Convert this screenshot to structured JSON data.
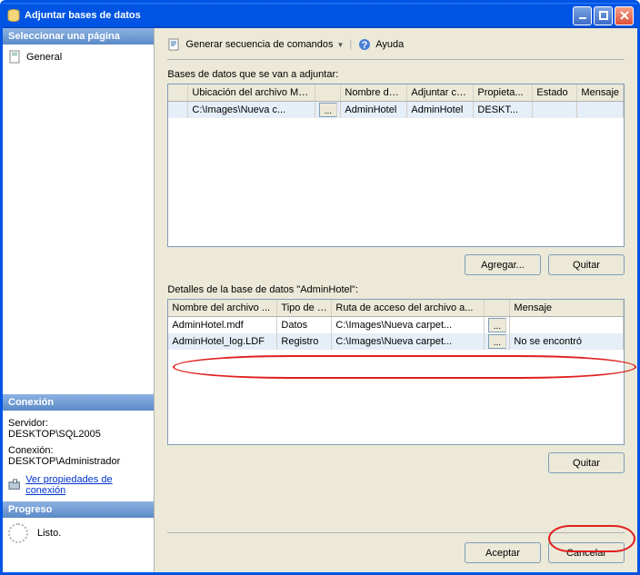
{
  "window": {
    "title": "Adjuntar bases de datos"
  },
  "sidebar": {
    "select_page": "Seleccionar una página",
    "general": "General",
    "connection_hdr": "Conexión",
    "server_label": "Servidor:",
    "server_value": "DESKTOP\\SQL2005",
    "conn_label": "Conexión:",
    "conn_value": "DESKTOP\\Administrador",
    "view_props": "Ver propiedades de conexión",
    "progress_hdr": "Progreso",
    "progress_status": "Listo."
  },
  "toolbar": {
    "script": "Generar secuencia de comandos",
    "help": "Ayuda"
  },
  "main": {
    "attach_label": "Bases de datos que se van a adjuntar:",
    "columns1": [
      "",
      "Ubicación del archivo MDF",
      "",
      "Nombre de ...",
      "Adjuntar co...",
      "Propieta...",
      "Estado",
      "Mensaje"
    ],
    "rows1": [
      {
        "path": "C:\\Images\\Nueva c...",
        "dots": "...",
        "name": "AdminHotel",
        "attach_as": "AdminHotel",
        "owner": "DESKT...",
        "state": "",
        "msg": ""
      }
    ],
    "add_btn": "Agregar...",
    "remove_btn": "Quitar",
    "details_label": "Detalles de la base de datos \"AdminHotel\":",
    "columns2": [
      "Nombre del archivo ...",
      "Tipo de ar...",
      "Ruta de acceso del archivo a...",
      "",
      "Mensaje"
    ],
    "rows2": [
      {
        "file": "AdminHotel.mdf",
        "type": "Datos",
        "path": "C:\\Images\\Nueva carpet...",
        "dots": "...",
        "msg": ""
      },
      {
        "file": "AdminHotel_log.LDF",
        "type": "Registro",
        "path": "C:\\Images\\Nueva carpet...",
        "dots": "...",
        "msg": "No se encontró"
      }
    ],
    "remove_btn2": "Quitar"
  },
  "footer": {
    "ok": "Aceptar",
    "cancel": "Cancelar"
  }
}
